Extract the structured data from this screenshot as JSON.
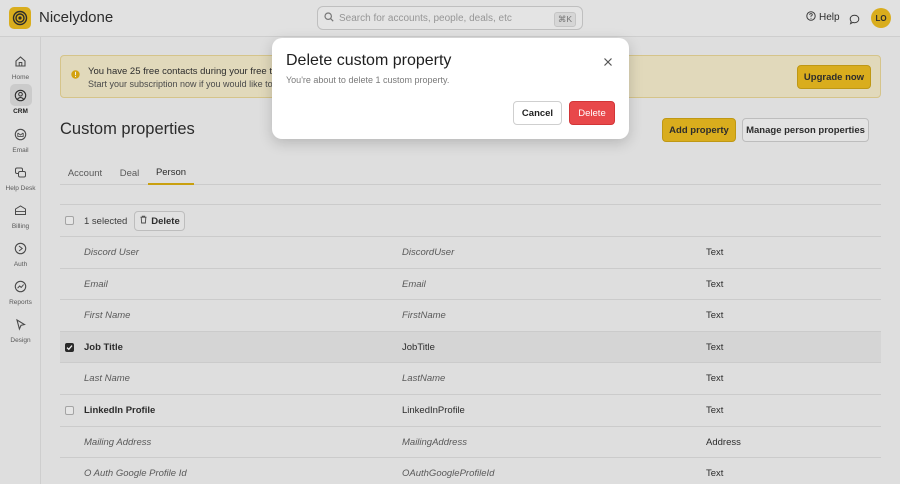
{
  "app": {
    "title": "Nicelydone",
    "avatar_initials": "LO"
  },
  "search": {
    "placeholder": "Search for accounts, people, deals, etc",
    "shortcut": "⌘K"
  },
  "header": {
    "help_label": "Help"
  },
  "sidebar": {
    "items": [
      {
        "label": "Home",
        "icon": "home-icon",
        "active": false
      },
      {
        "label": "CRM",
        "icon": "crm-icon",
        "active": true
      },
      {
        "label": "Email",
        "icon": "email-icon",
        "active": false
      },
      {
        "label": "Help Desk",
        "icon": "help-desk-icon",
        "active": false
      },
      {
        "label": "Billing",
        "icon": "billing-icon",
        "active": false
      },
      {
        "label": "Auth",
        "icon": "auth-icon",
        "active": false
      },
      {
        "label": "Reports",
        "icon": "reports-icon",
        "active": false
      },
      {
        "label": "Design",
        "icon": "design-icon",
        "active": false
      }
    ]
  },
  "banner": {
    "title": "You have 25 free contacts during your free trial",
    "subtitle": "Start your subscription now if you would like to i",
    "upgrade_label": "Upgrade now"
  },
  "main": {
    "title": "Custom properties",
    "add_property_label": "Add property",
    "manage_label": "Manage person properties",
    "tabs": [
      {
        "label": "Account",
        "active": false
      },
      {
        "label": "Deal",
        "active": false
      },
      {
        "label": "Person",
        "active": true
      }
    ]
  },
  "table": {
    "selected_text": "1 selected",
    "delete_label": "Delete",
    "rows": [
      {
        "name": "Discord User",
        "key": "DiscordUser",
        "type": "Text",
        "custom": false,
        "checked": false
      },
      {
        "name": "Email",
        "key": "Email",
        "type": "Text",
        "custom": false,
        "checked": false
      },
      {
        "name": "First Name",
        "key": "FirstName",
        "type": "Text",
        "custom": false,
        "checked": false
      },
      {
        "name": "Job Title",
        "key": "JobTitle",
        "type": "Text",
        "custom": true,
        "checked": true
      },
      {
        "name": "Last Name",
        "key": "LastName",
        "type": "Text",
        "custom": false,
        "checked": false
      },
      {
        "name": "LinkedIn Profile",
        "key": "LinkedInProfile",
        "type": "Text",
        "custom": true,
        "checked": false
      },
      {
        "name": "Mailing Address",
        "key": "MailingAddress",
        "type": "Address",
        "custom": false,
        "checked": false
      },
      {
        "name": "O Auth Google Profile Id",
        "key": "OAuthGoogleProfileId",
        "type": "Text",
        "custom": false,
        "checked": false
      }
    ]
  },
  "modal": {
    "title": "Delete custom property",
    "description": "You're about to delete 1 custom property.",
    "cancel_label": "Cancel",
    "confirm_label": "Delete"
  },
  "colors": {
    "accent": "#e6b411",
    "danger": "#e8484a",
    "banner_bg": "#efe6c4"
  }
}
